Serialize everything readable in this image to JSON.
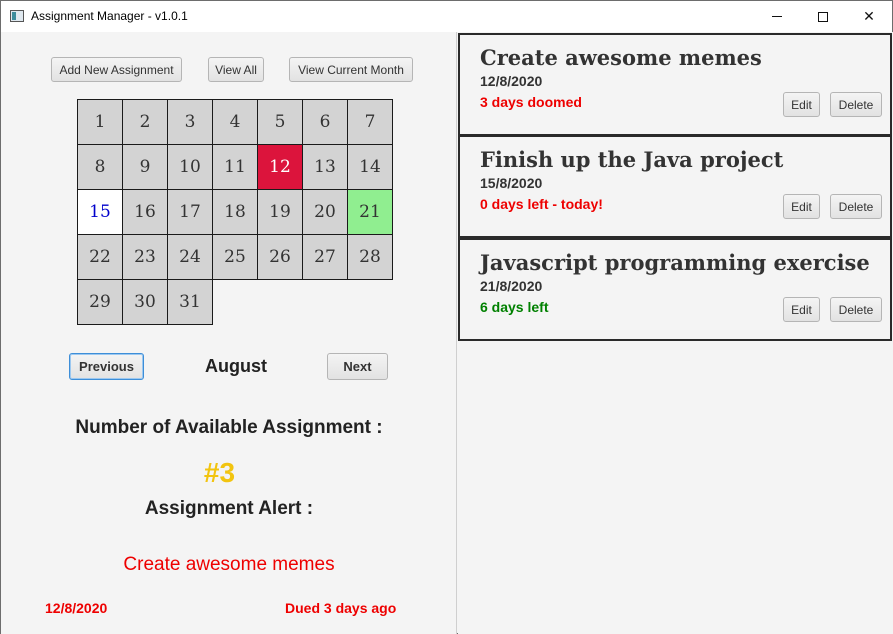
{
  "window": {
    "title": "Assignment Manager - v1.0.1"
  },
  "toolbar": {
    "add_label": "Add New Assignment",
    "view_all_label": "View All",
    "view_month_label": "View Current Month"
  },
  "calendar": {
    "days": [
      "1",
      "2",
      "3",
      "4",
      "5",
      "6",
      "7",
      "8",
      "9",
      "10",
      "11",
      "12",
      "13",
      "14",
      "15",
      "16",
      "17",
      "18",
      "19",
      "20",
      "21",
      "22",
      "23",
      "24",
      "25",
      "26",
      "27",
      "28",
      "29",
      "30",
      "31"
    ],
    "today": "15",
    "highlight_red": "12",
    "highlight_green": "21",
    "colors": {
      "red": "#dc143c",
      "green": "#90ee90",
      "today_text": "#0000cc",
      "cell": "#d3d3d3"
    }
  },
  "nav": {
    "previous_label": "Previous",
    "month": "August",
    "next_label": "Next"
  },
  "summary": {
    "available_label": "Number of Available Assignment :",
    "count": "#3",
    "alert_label": "Assignment Alert :",
    "alert_title": "Create awesome memes",
    "alert_date": "12/8/2020",
    "alert_due": "Dued 3 days ago"
  },
  "assignments": [
    {
      "title": "Create awesome memes",
      "date": "12/8/2020",
      "status": "3 days doomed",
      "status_color": "red",
      "edit_label": "Edit",
      "delete_label": "Delete"
    },
    {
      "title": "Finish up the Java project",
      "date": "15/8/2020",
      "status": "0 days left - today!",
      "status_color": "red",
      "edit_label": "Edit",
      "delete_label": "Delete"
    },
    {
      "title": "Javascript programming exercise",
      "date": "21/8/2020",
      "status": "6 days left",
      "status_color": "green",
      "edit_label": "Edit",
      "delete_label": "Delete"
    }
  ]
}
